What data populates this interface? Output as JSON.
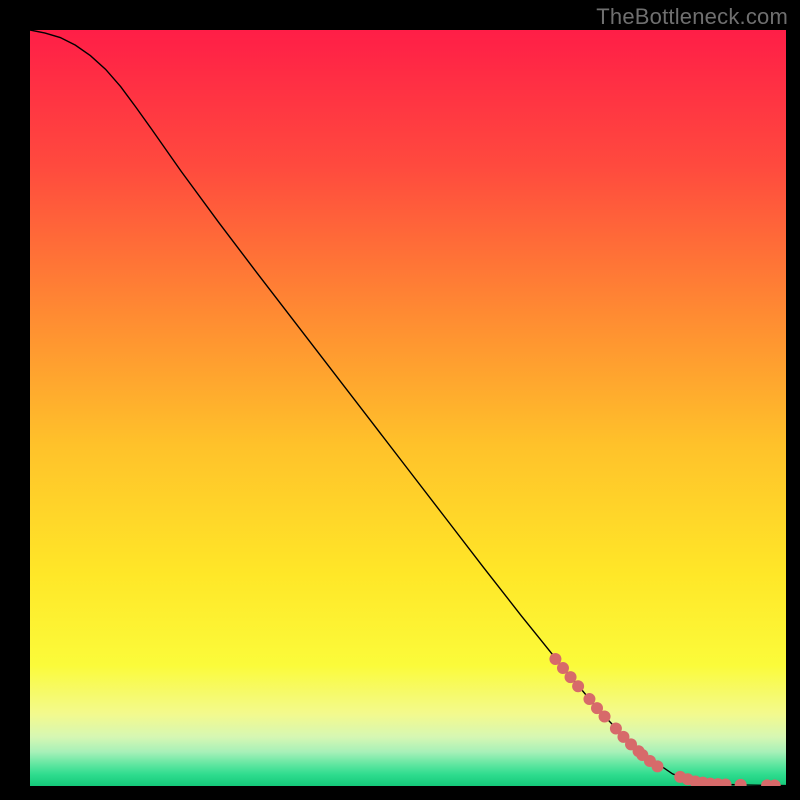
{
  "watermark": "TheBottleneck.com",
  "chart_data": {
    "type": "line",
    "title": "",
    "xlabel": "",
    "ylabel": "",
    "xlim": [
      0,
      100
    ],
    "ylim": [
      0,
      100
    ],
    "grid": false,
    "legend": false,
    "axes_visible": false,
    "background": {
      "type": "vertical_gradient",
      "stops": [
        {
          "pos": 0.0,
          "color": "#FF1E47"
        },
        {
          "pos": 0.18,
          "color": "#FF4A3E"
        },
        {
          "pos": 0.38,
          "color": "#FF8C32"
        },
        {
          "pos": 0.55,
          "color": "#FFC22A"
        },
        {
          "pos": 0.72,
          "color": "#FFE728"
        },
        {
          "pos": 0.84,
          "color": "#FBFB3A"
        },
        {
          "pos": 0.905,
          "color": "#F3FA8E"
        },
        {
          "pos": 0.935,
          "color": "#D6F7B3"
        },
        {
          "pos": 0.955,
          "color": "#A7F0B8"
        },
        {
          "pos": 0.972,
          "color": "#5EE6A0"
        },
        {
          "pos": 0.985,
          "color": "#2EDC8E"
        },
        {
          "pos": 1.0,
          "color": "#14C879"
        }
      ]
    },
    "series": [
      {
        "name": "curve",
        "style": "solid",
        "color": "#000000",
        "width": 1.4,
        "x": [
          0,
          2,
          4,
          6,
          8,
          10,
          12,
          14,
          16,
          20,
          25,
          30,
          35,
          40,
          45,
          50,
          55,
          60,
          65,
          70,
          75,
          80,
          85,
          87,
          89,
          90,
          92,
          95,
          98,
          100
        ],
        "y": [
          100,
          99.6,
          99.0,
          98.0,
          96.6,
          94.8,
          92.5,
          89.8,
          87.0,
          81.3,
          74.5,
          67.9,
          61.4,
          54.9,
          48.4,
          41.9,
          35.4,
          28.9,
          22.5,
          16.3,
          10.3,
          5.0,
          1.6,
          0.9,
          0.45,
          0.32,
          0.2,
          0.12,
          0.08,
          0.06
        ]
      },
      {
        "name": "markers",
        "type": "scatter",
        "color": "#D76A6A",
        "radius": 6,
        "points": [
          {
            "x": 69.5,
            "y": 16.8
          },
          {
            "x": 70.5,
            "y": 15.6
          },
          {
            "x": 71.5,
            "y": 14.4
          },
          {
            "x": 72.5,
            "y": 13.2
          },
          {
            "x": 74.0,
            "y": 11.5
          },
          {
            "x": 75.0,
            "y": 10.3
          },
          {
            "x": 76.0,
            "y": 9.2
          },
          {
            "x": 77.5,
            "y": 7.6
          },
          {
            "x": 78.5,
            "y": 6.5
          },
          {
            "x": 79.5,
            "y": 5.5
          },
          {
            "x": 80.5,
            "y": 4.6
          },
          {
            "x": 81.0,
            "y": 4.1
          },
          {
            "x": 82.0,
            "y": 3.3
          },
          {
            "x": 83.0,
            "y": 2.6
          },
          {
            "x": 86.0,
            "y": 1.2
          },
          {
            "x": 87.0,
            "y": 0.9
          },
          {
            "x": 88.0,
            "y": 0.6
          },
          {
            "x": 89.0,
            "y": 0.45
          },
          {
            "x": 90.0,
            "y": 0.32
          },
          {
            "x": 91.0,
            "y": 0.25
          },
          {
            "x": 92.0,
            "y": 0.2
          },
          {
            "x": 94.0,
            "y": 0.15
          },
          {
            "x": 97.5,
            "y": 0.08
          },
          {
            "x": 98.5,
            "y": 0.07
          }
        ]
      }
    ]
  }
}
